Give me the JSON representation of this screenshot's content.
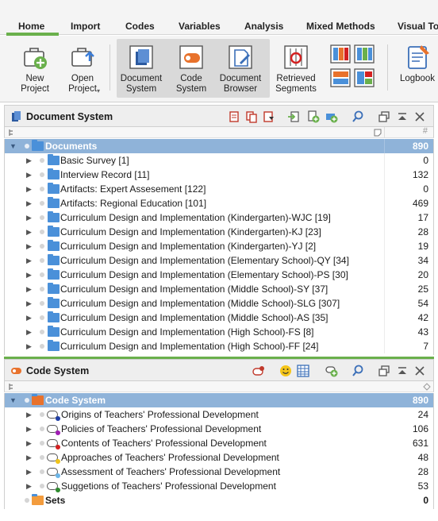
{
  "tabs": [
    {
      "label": "Home",
      "active": true
    },
    {
      "label": "Import"
    },
    {
      "label": "Codes"
    },
    {
      "label": "Variables"
    },
    {
      "label": "Analysis"
    },
    {
      "label": "Mixed Methods"
    },
    {
      "label": "Visual To"
    }
  ],
  "ribbon": {
    "new_project": "New\nProject",
    "open_project": "Open\nProject",
    "document_system": "Document\nSystem",
    "code_system": "Code\nSystem",
    "document_browser": "Document\nBrowser",
    "retrieved_segments": "Retrieved\nSegments",
    "logbook": "Logbook"
  },
  "document_panel": {
    "title": "Document System",
    "hash_symbol": "#",
    "root": {
      "label": "Documents",
      "count": "890"
    },
    "items": [
      {
        "label": "Basic Survey [1]",
        "count": "0"
      },
      {
        "label": "Interview Record [11]",
        "count": "132"
      },
      {
        "label": "Artifacts: Expert Assesement [122]",
        "count": "0"
      },
      {
        "label": "Artifacts: Regional Education [101]",
        "count": "469"
      },
      {
        "label": "Curriculum Design and Implementation (Kindergarten)-WJC [19]",
        "count": "17"
      },
      {
        "label": "Curriculum Design and Implementation (Kindergarten)-KJ [23]",
        "count": "28"
      },
      {
        "label": "Curriculum Design and Implementation (Kindergarten)-YJ [2]",
        "count": "19"
      },
      {
        "label": "Curriculum Design and Implementation (Elementary School)-QY [34]",
        "count": "34"
      },
      {
        "label": "Curriculum Design and Implementation (Elementary School)-PS [30]",
        "count": "20"
      },
      {
        "label": "Curriculum Design and Implementation (Middle School)-SY [37]",
        "count": "25"
      },
      {
        "label": "Curriculum Design and Implementation (Middle School)-SLG [307]",
        "count": "54"
      },
      {
        "label": "Curriculum Design and Implementation (Middle School)-AS [35]",
        "count": "42"
      },
      {
        "label": "Curriculum Design and Implementation (High School)-FS [8]",
        "count": "43"
      },
      {
        "label": "Curriculum Design and Implementation (High School)-FF [24]",
        "count": "7"
      }
    ]
  },
  "code_panel": {
    "title": "Code System",
    "root": {
      "label": "Code System",
      "count": "890"
    },
    "items": [
      {
        "label": "Origins of Teachers' Professional Development",
        "count": "24",
        "color": "#1f3fa6"
      },
      {
        "label": "Policies of Teachers' Professional Development",
        "count": "106",
        "color": "#a01cb4"
      },
      {
        "label": "Contents of Teachers' Professional Development",
        "count": "631",
        "color": "#d42020"
      },
      {
        "label": "Approaches of Teachers' Professional Development",
        "count": "48",
        "color": "#f0c419"
      },
      {
        "label": "Assessment of Teachers' Professional Development",
        "count": "28",
        "color": "#6cb6e8"
      },
      {
        "label": "Suggetions of Teachers' Professional Development",
        "count": "53",
        "color": "#2e8b2e"
      }
    ],
    "sets": {
      "label": "Sets",
      "count": "0"
    }
  },
  "colors": {
    "accent_green": "#6ab04c",
    "selection_blue": "#8fb3d9",
    "folder_blue": "#4a90d9",
    "code_orange": "#e8722c"
  }
}
